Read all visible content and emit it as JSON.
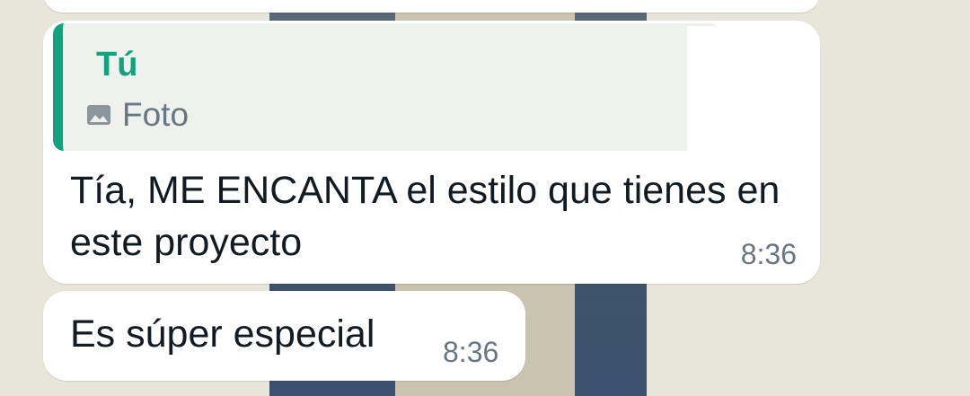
{
  "conversation": {
    "messages": [
      {
        "quote": {
          "author": "Tú",
          "type_label": "Foto",
          "type_icon": "photo-icon"
        },
        "text": "Tía, ME ENCANTA el estilo que tienes en este proyecto",
        "time": "8:36"
      },
      {
        "text": "Es súper especial",
        "time": "8:36"
      }
    ]
  },
  "colors": {
    "wallpaper": "#e8e6d8",
    "bubble": "#ffffff",
    "quote_accent": "#12a27f",
    "quote_bg": "#eef1ec",
    "meta_text": "#667781",
    "body_text": "#111b21"
  }
}
